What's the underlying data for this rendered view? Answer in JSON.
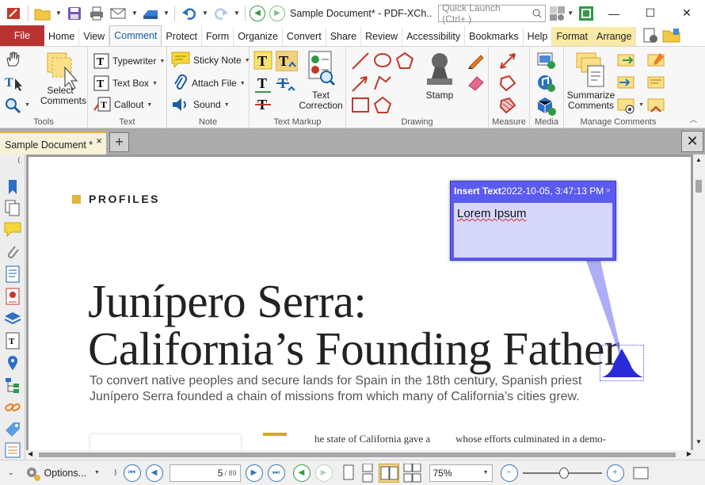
{
  "titlebar": {
    "doc_title": "Sample Document* - PDF-XCh..",
    "quick_launch_placeholder": "Quick Launch (Ctrl+.)",
    "minimize": "—",
    "maximize": "☐",
    "close": "✕"
  },
  "menu": {
    "file": "File",
    "tabs": [
      "Home",
      "View",
      "Comment",
      "Protect",
      "Form",
      "Organize",
      "Convert",
      "Share",
      "Review",
      "Accessibility",
      "Bookmarks",
      "Help",
      "Format",
      "Arrange"
    ],
    "active": "Comment"
  },
  "ribbon": {
    "tools": {
      "label": "Tools",
      "select_comments": "Select Comments"
    },
    "text": {
      "label": "Text",
      "typewriter": "Typewriter",
      "text_box": "Text Box",
      "callout": "Callout"
    },
    "note": {
      "label": "Note",
      "sticky_note": "Sticky Note",
      "attach_file": "Attach File",
      "sound": "Sound"
    },
    "text_markup": {
      "label": "Text Markup",
      "text_correction": "Text Correction"
    },
    "drawing": {
      "label": "Drawing",
      "stamp": "Stamp"
    },
    "measure": {
      "label": "Measure"
    },
    "media": {
      "label": "Media"
    },
    "manage": {
      "label": "Manage Comments",
      "summarize": "Summarize Comments"
    }
  },
  "tabs": {
    "document_tab": "Sample Document *",
    "close": "×",
    "new_tab": "+"
  },
  "page": {
    "section": "PROFILES",
    "headline_line1": "Junípero Serra:",
    "headline_line2": "California’s Founding Father",
    "subhead": "To convert native peoples and secure lands for Spain in the 18th century, Spanish priest Junípero Serra founded a chain of missions from which many of California’s cities grew.",
    "body_col1": "he state of California gave a",
    "body_col2": "whose efforts culminated in a demo-"
  },
  "annotation": {
    "author": "Insert Text",
    "timestamp": "2022-10-05, 3:47:13 PM",
    "close": "×",
    "content": "Lorem Ipsum"
  },
  "status": {
    "options": "Options...",
    "current_page": "5",
    "total_pages": "/ 89",
    "zoom": "75%"
  },
  "colors": {
    "file_tab": "#b83232",
    "accent_gold": "#e2b43c",
    "popup": "#5b5bf0",
    "popup_body": "#d6d6fa"
  }
}
